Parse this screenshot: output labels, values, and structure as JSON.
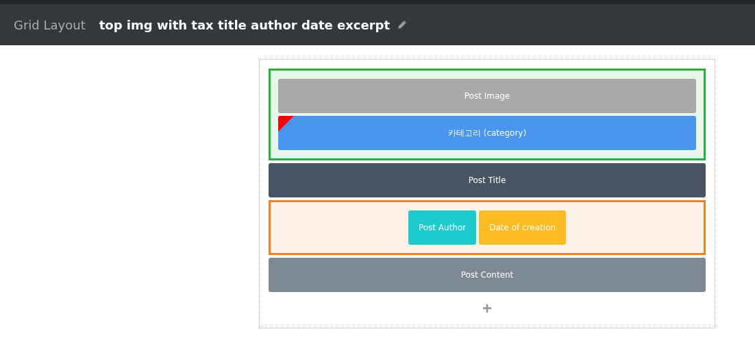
{
  "header": {
    "section": "Grid Layout",
    "title": "top img with tax title author date excerpt"
  },
  "rows": [
    {
      "kind": "stack",
      "color": "#22b33a",
      "children": [
        {
          "kind": "block",
          "label": "Post Image",
          "color": "#a9a9a9",
          "flagged": false
        },
        {
          "kind": "block",
          "label": "카테고리 (category)",
          "color": "#4896f0",
          "flagged": true
        }
      ]
    },
    {
      "kind": "block",
      "label": "Post Title",
      "color": "#475562",
      "flagged": false
    },
    {
      "kind": "inline",
      "color": "#f5821f",
      "children": [
        {
          "kind": "block",
          "label": "Post Author",
          "color": "#1ecbcc",
          "flagged": false
        },
        {
          "kind": "block",
          "label": "Date of creation",
          "color": "#fbbb22",
          "flagged": false
        }
      ]
    },
    {
      "kind": "block",
      "label": "Post Content",
      "color": "#7d8893",
      "flagged": false
    }
  ],
  "add_button": "+"
}
